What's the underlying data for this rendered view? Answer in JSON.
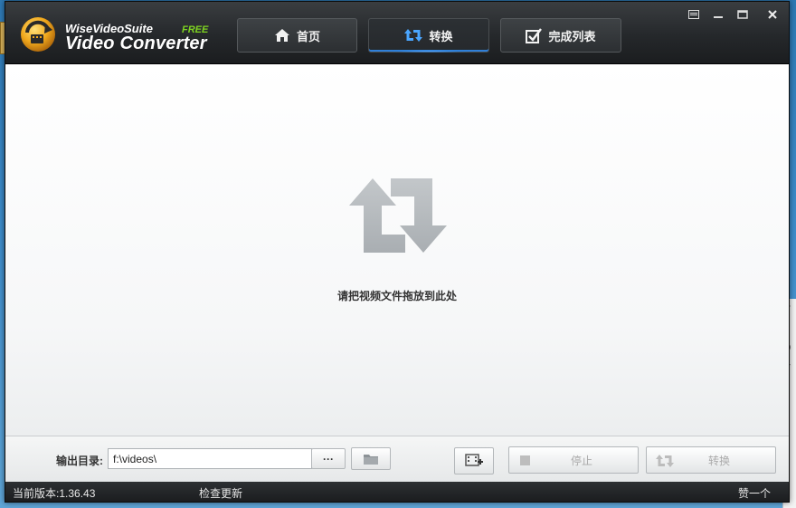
{
  "app": {
    "brand_small": "WiseVideoSuite",
    "brand_free": "FREE",
    "brand_big": "Video Converter"
  },
  "tabs": [
    {
      "label": "首页",
      "icon": "home-icon",
      "active": false
    },
    {
      "label": "转换",
      "icon": "convert-icon",
      "active": true
    },
    {
      "label": "完成列表",
      "icon": "checklist-icon",
      "active": false
    }
  ],
  "window_controls": [
    "menu-icon",
    "minimize-icon",
    "maximize-icon",
    "close-icon"
  ],
  "main": {
    "drop_hint": "请把视频文件拖放到此处"
  },
  "bottom": {
    "output_label": "输出目录:",
    "output_value": "f:\\videos\\",
    "browse_label": "···",
    "stop_label": "停止",
    "convert_label": "转换"
  },
  "status": {
    "version": "当前版本:1.36.43",
    "check_update": "检查更新",
    "like": "赞一个"
  },
  "desktop_fragment": [
    "v",
    "\\",
    "0",
    "7"
  ],
  "colors": {
    "accent": "#2f7fd8",
    "free": "#7ed321",
    "titlebar": "#25282b"
  }
}
